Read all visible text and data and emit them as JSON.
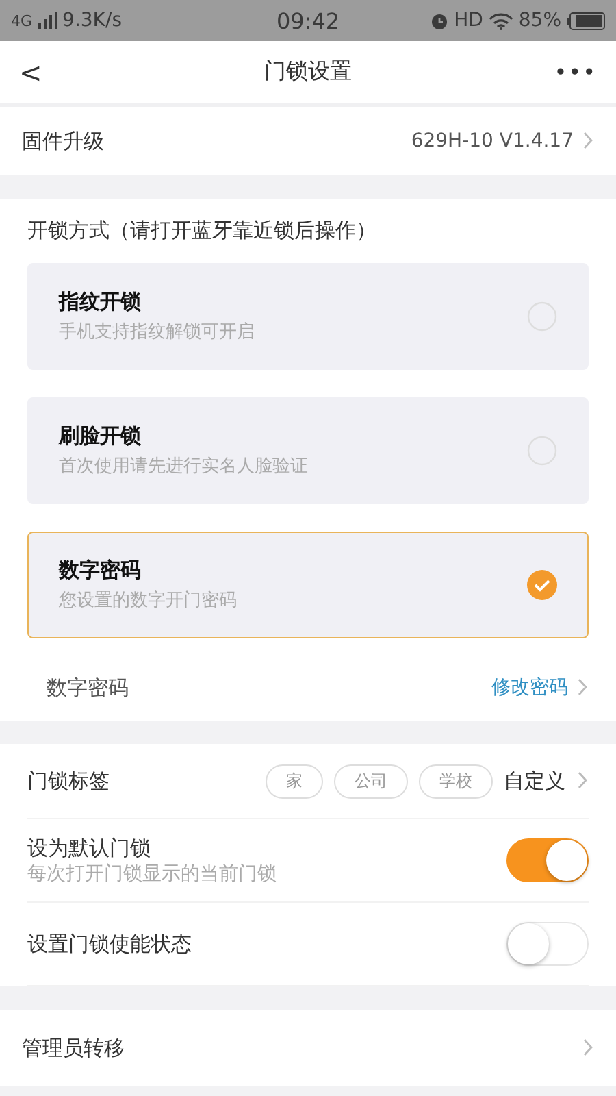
{
  "status_bar": {
    "network": "4G",
    "speed": "9.3K/s",
    "time": "09:42",
    "hd": "HD",
    "battery": "85%"
  },
  "nav": {
    "back": "<",
    "title": "门锁设置",
    "more": "•••"
  },
  "firmware": {
    "label": "固件升级",
    "value": "629H-10 V1.4.17"
  },
  "unlock": {
    "heading": "开锁方式（请打开蓝牙靠近锁后操作）",
    "methods": [
      {
        "title": "指纹开锁",
        "subtitle": "手机支持指纹解锁可开启",
        "selected": false
      },
      {
        "title": "刷脸开锁",
        "subtitle": "首次使用请先进行实名人脸验证",
        "selected": false
      },
      {
        "title": "数字密码",
        "subtitle": "您设置的数字开门密码",
        "selected": true
      }
    ],
    "password": {
      "label": "数字密码",
      "action": "修改密码"
    }
  },
  "tags": {
    "label": "门锁标签",
    "items": [
      "家",
      "公司",
      "学校"
    ],
    "custom": "自定义"
  },
  "toggles": [
    {
      "label": "设为默认门锁",
      "subtitle": "每次打开门锁显示的当前门锁",
      "on": true
    },
    {
      "label": "设置门锁使能状态",
      "on": false
    }
  ],
  "admin": {
    "label": "管理员转移"
  }
}
